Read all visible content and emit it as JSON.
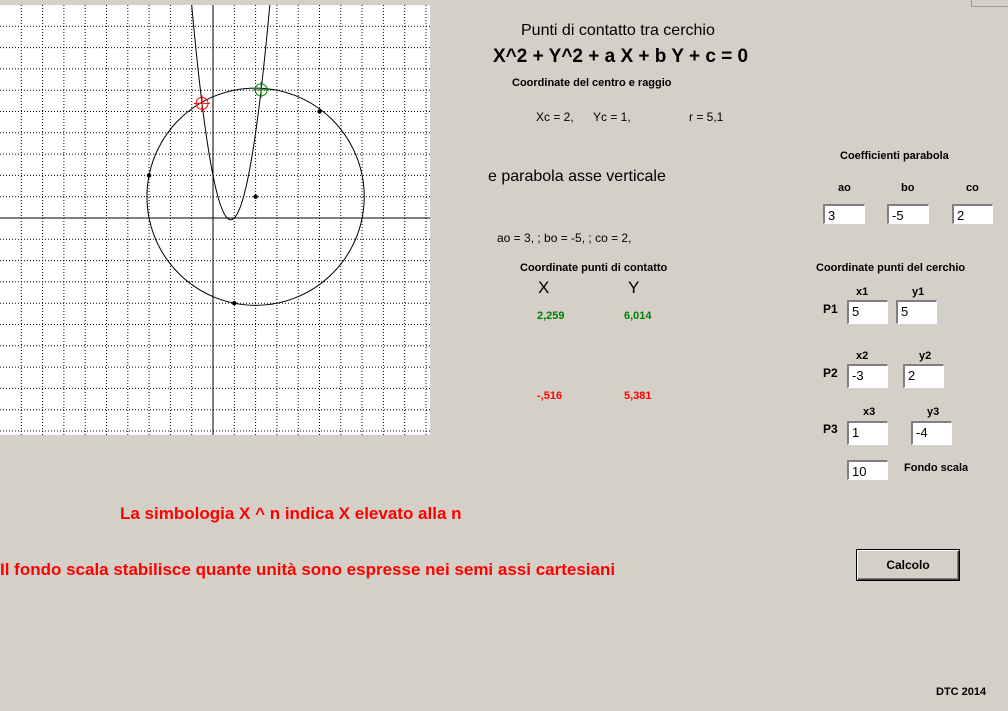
{
  "title": "Punti di contatto tra cerchio",
  "equation": "X^2 + Y^2 + a  X + b Y + c = 0",
  "center_heading": "Coordinate del centro e raggio",
  "center": {
    "xc": "Xc =  2,",
    "yc": "Yc =  1,",
    "r": "r =  5,1"
  },
  "parabola_heading": "e parabola asse verticale",
  "coefficients_line": "ao =  3,  ;  bo =  -5,  ;  co =  2,",
  "contact": {
    "heading": "Coordinate punti di contatto",
    "x_header": "X",
    "y_header": "Y",
    "points": [
      {
        "x": "2,259",
        "y": "6,014",
        "color": "#008000"
      },
      {
        "x": "-,516",
        "y": "5,381",
        "color": "#ff0000"
      }
    ]
  },
  "coeff_panel": {
    "heading": "Coefficienti   parabola",
    "ao_label": "ao",
    "bo_label": "bo",
    "co_label": "co",
    "ao": "3",
    "bo": "-5",
    "co": "2"
  },
  "circle_points": {
    "heading": "Coordinate punti del cerchio",
    "p1": {
      "label": "P1",
      "x_label": "x1",
      "y_label": "y1",
      "x": "5",
      "y": "5"
    },
    "p2": {
      "label": "P2",
      "x_label": "x2",
      "y_label": "y2",
      "x": "-3",
      "y": "2"
    },
    "p3": {
      "label": "P3",
      "x_label": "x3",
      "y_label": "y3",
      "x": "1",
      "y": "-4"
    }
  },
  "scale": {
    "value": "10",
    "label": "Fondo scala"
  },
  "calc_button": "Calcolo",
  "note1": "La simbologia   X ^ n   indica  X  elevato alla  n",
  "note2": "Il fondo scala stabilisce quante unità sono espresse nei semi assi cartesiani",
  "footer": "DTC 2014",
  "colors": {
    "window": "#d4d0c8",
    "accent_red": "#ff0000",
    "green": "#008000"
  },
  "graph": {
    "scale": 10,
    "circle": {
      "xc": 2,
      "yc": 1,
      "r": 5.1
    },
    "parabola": {
      "a": 3,
      "b": -5,
      "c": 2
    },
    "circle_points": [
      [
        5,
        5
      ],
      [
        -3,
        2
      ],
      [
        1,
        -4
      ]
    ],
    "contact_points": [
      [
        2.259,
        6.014
      ],
      [
        -0.516,
        5.381
      ]
    ]
  }
}
